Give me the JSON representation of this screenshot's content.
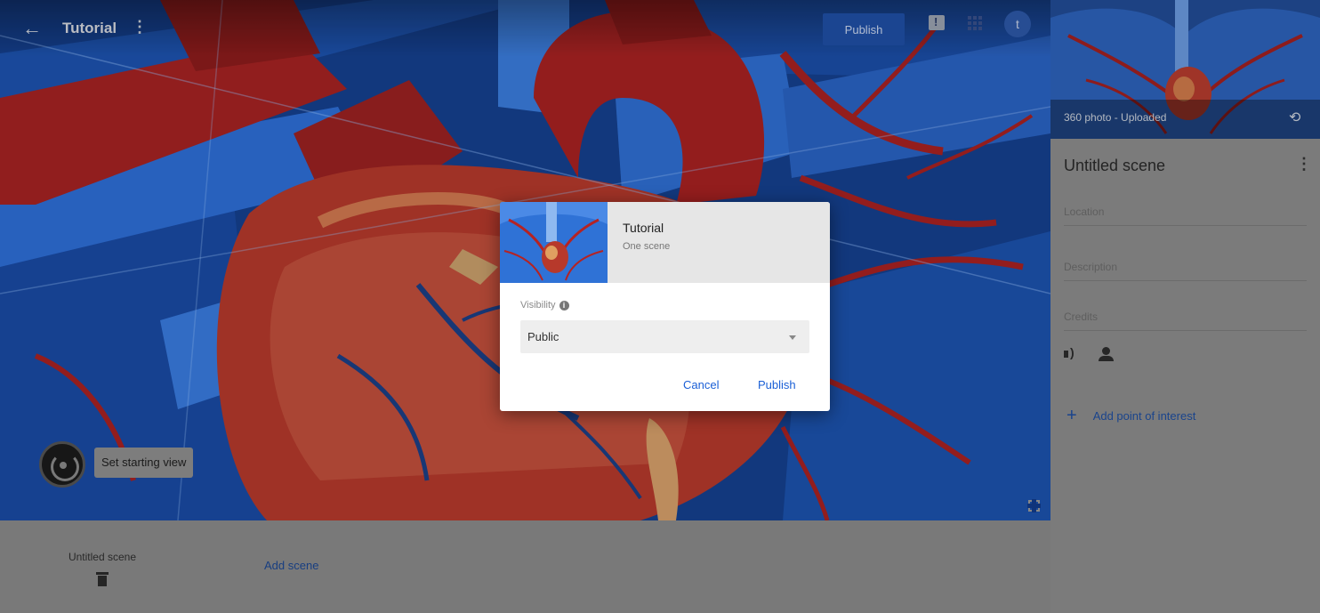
{
  "topbar": {
    "back_icon": "arrow-back-icon",
    "tour_title": "Tutorial",
    "menu_glyph": "⋮",
    "publish_label": "Publish",
    "feedback_icon": "feedback-icon",
    "apps_icon": "apps-grid-icon",
    "avatar_letter": "t"
  },
  "viewer": {
    "set_start_label": "Set starting view",
    "start_icon": "starting-view-icon",
    "fullscreen_icon": "fullscreen-icon"
  },
  "filmstrip": {
    "scenes": [
      {
        "label": "Untitled scene",
        "icon": "trash-icon"
      }
    ],
    "add_scene_label": "Add scene"
  },
  "panel": {
    "thumb_label": "360 photo - Uploaded",
    "thumb_icon": "rotate-icon",
    "scene_title": "Untitled scene",
    "menu_glyph": "⋮",
    "location_placeholder": "Location",
    "description_placeholder": "Description",
    "credits_placeholder": "Credits",
    "sound_icon": "volume-icon",
    "narration_icon": "narration-icon",
    "add_poi_label": "Add point of interest",
    "add_poi_glyph": "+"
  },
  "dialog": {
    "title": "Tutorial",
    "subtitle": "One scene",
    "visibility_label": "Visibility",
    "info_glyph": "i",
    "visibility_value": "Public",
    "cancel_label": "Cancel",
    "publish_label": "Publish"
  },
  "colors": {
    "accent": "#1a5fd6",
    "publish_button": "#1f4fa5",
    "panel_bg": "#8c8c8c",
    "filmstrip_bg": "#8a8a8a"
  }
}
